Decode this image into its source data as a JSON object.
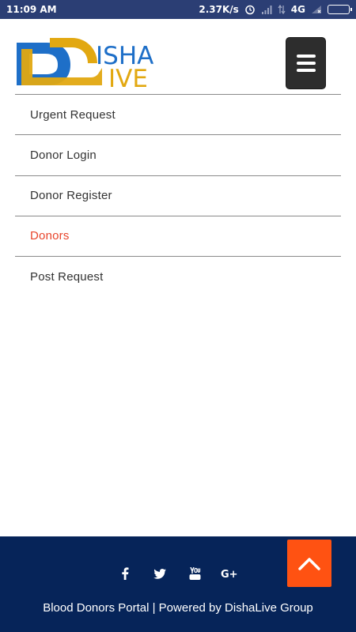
{
  "status_bar": {
    "time": "11:09 AM",
    "speed": "2.37K/s",
    "network": "4G",
    "icons": [
      "alarm-icon",
      "signal-icon",
      "data-arrows-icon",
      "signal-no-service-icon",
      "battery-icon"
    ]
  },
  "header": {
    "logo_text_top": "ISHA",
    "logo_text_bottom": "IVE",
    "menu_icon": "hamburger-icon"
  },
  "nav": {
    "items": [
      {
        "label": "Urgent Request",
        "active": false
      },
      {
        "label": "Donor Login",
        "active": false
      },
      {
        "label": "Donor Register",
        "active": false
      },
      {
        "label": "Donors",
        "active": true
      },
      {
        "label": "Post Request",
        "active": false
      }
    ]
  },
  "footer": {
    "social_icons": [
      "facebook-icon",
      "twitter-icon",
      "youtube-icon",
      "google-plus-icon"
    ],
    "text": "Blood Donors Portal | Powered by DishaLive Group"
  },
  "colors": {
    "statusbar": "#2b3e74",
    "active_nav": "#e8452c",
    "footer_bg": "#062459",
    "back_to_top": "#ff5212",
    "logo_blue": "#1e6fc8",
    "logo_gold": "#e2a811"
  }
}
